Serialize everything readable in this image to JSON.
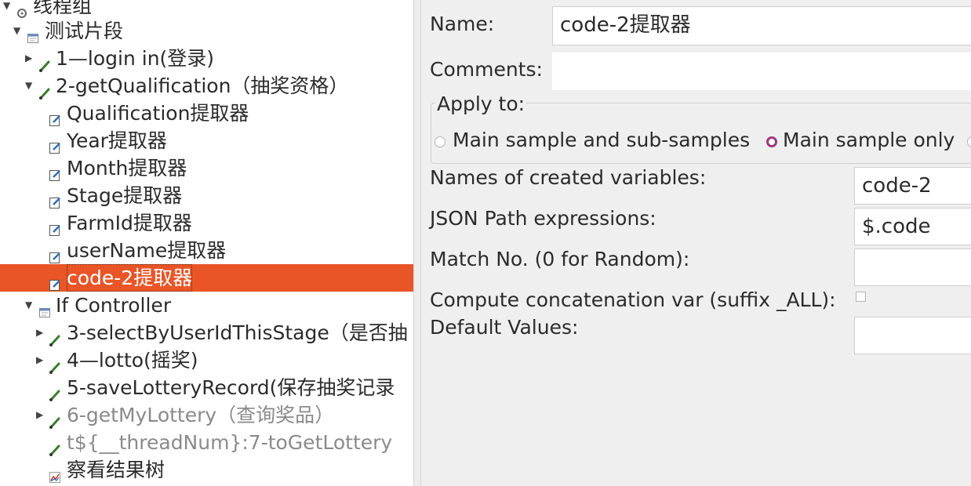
{
  "tree": {
    "items": [
      {
        "label": "线程组",
        "icon": "thread-group-icon"
      },
      {
        "label": "测试片段",
        "icon": "fragment-icon"
      },
      {
        "label": "1—login in(登录)",
        "icon": "http-sampler-icon"
      },
      {
        "label": "2-getQualification（抽奖资格）",
        "icon": "http-sampler-icon"
      },
      {
        "label": "Qualification提取器",
        "icon": "extractor-icon"
      },
      {
        "label": "Year提取器",
        "icon": "extractor-icon"
      },
      {
        "label": "Month提取器",
        "icon": "extractor-icon"
      },
      {
        "label": "Stage提取器",
        "icon": "extractor-icon"
      },
      {
        "label": "FarmId提取器",
        "icon": "extractor-icon"
      },
      {
        "label": "userName提取器",
        "icon": "extractor-icon"
      },
      {
        "label": "code-2提取器",
        "icon": "extractor-icon"
      },
      {
        "label": "If Controller",
        "icon": "controller-icon"
      },
      {
        "label": "3-selectByUserIdThisStage（是否抽",
        "icon": "http-sampler-icon"
      },
      {
        "label": "4—lotto(摇奖)",
        "icon": "http-sampler-icon"
      },
      {
        "label": "5-saveLotteryRecord(保存抽奖记录",
        "icon": "http-sampler-icon"
      },
      {
        "label": "6-getMyLottery（查询奖品）",
        "icon": "http-sampler-icon"
      },
      {
        "label": "t${__threadNum}:7-toGetLottery",
        "icon": "http-sampler-icon"
      },
      {
        "label": "察看结果树",
        "icon": "result-tree-icon"
      }
    ],
    "selected": "code-2提取器"
  },
  "form": {
    "name_label": "Name:",
    "name_value": "code-2提取器",
    "comments_label": "Comments:",
    "comments_value": "",
    "apply_to_label": "Apply to:",
    "apply_options": [
      "Main sample and sub-samples",
      "Main sample only"
    ],
    "apply_selected": "Main sample only",
    "variables_label": "Names of created variables:",
    "variables_value": "code-2",
    "jsonpath_label": "JSON Path expressions:",
    "jsonpath_value": "$.code",
    "match_label": "Match No. (0 for Random):",
    "match_value": "",
    "concat_label": "Compute concatenation var (suffix _ALL):",
    "concat_checked": false,
    "default_label": "Default Values:",
    "default_value": ""
  },
  "colors": {
    "selection": "#ea5527",
    "panel_bg": "#efefef",
    "radio_selected": "#9b3a7a"
  }
}
